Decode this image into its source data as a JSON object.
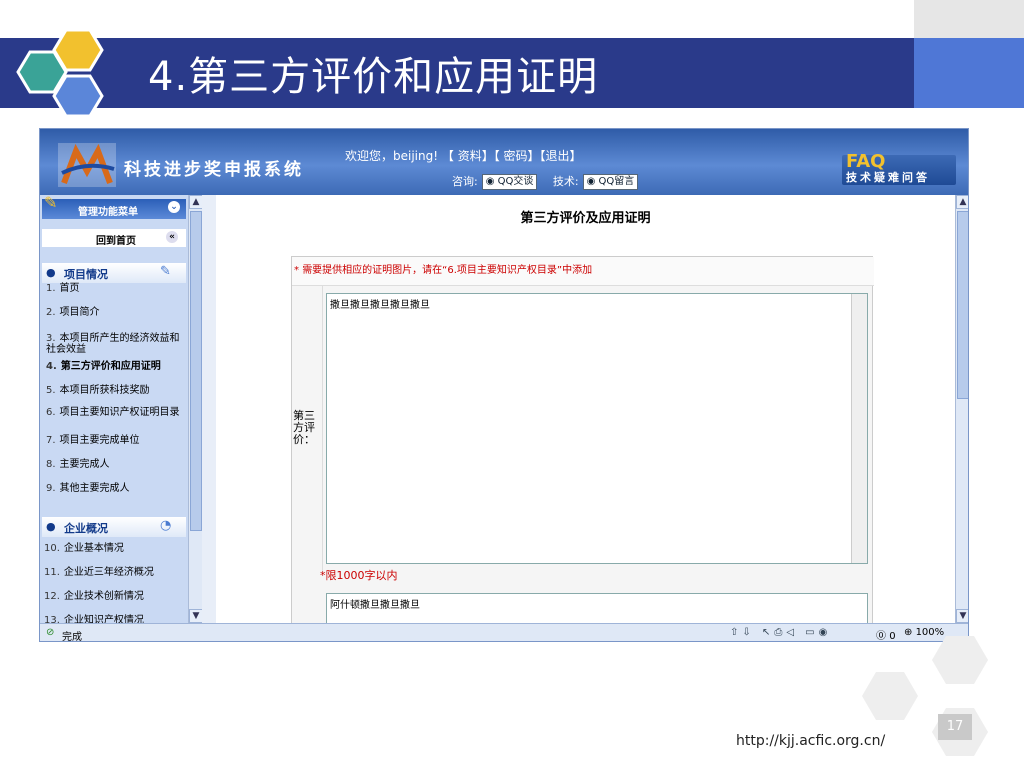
{
  "slide": {
    "title": "4.第三方评价和应用证明",
    "url": "http://kjj.acfic.org.cn/",
    "page_number": "17"
  },
  "app": {
    "system_name": "科技进步奖申报系统",
    "welcome_text": "欢迎您，beijing!",
    "links": [
      "【 资料】",
      "【 密码】",
      "【退出】"
    ],
    "consult_label": "咨询:",
    "qq_chat": "QQ交谈",
    "tech_label": "技术:",
    "qq_message": "QQ留言",
    "faq_letters": "FAQ",
    "faq_caption": "技术疑难问答"
  },
  "sidebar": {
    "menu_title": "管理功能菜单",
    "back_home": "回到首页",
    "section1": "项目情况",
    "items1": [
      {
        "n": "1.",
        "label": "首页"
      },
      {
        "n": "2.",
        "label": "项目简介"
      },
      {
        "n": "3.",
        "label": "本项目所产生的经济效益和社会效益"
      },
      {
        "n": "4.",
        "label": "第三方评价和应用证明"
      },
      {
        "n": "5.",
        "label": "本项目所获科技奖励"
      },
      {
        "n": "6.",
        "label": "项目主要知识产权证明目录"
      },
      {
        "n": "7.",
        "label": "项目主要完成单位"
      },
      {
        "n": "8.",
        "label": "主要完成人"
      },
      {
        "n": "9.",
        "label": "其他主要完成人"
      }
    ],
    "section2": "企业概况",
    "items2": [
      {
        "n": "10.",
        "label": "企业基本情况"
      },
      {
        "n": "11.",
        "label": "企业近三年经济概况"
      },
      {
        "n": "12.",
        "label": "企业技术创新情况"
      },
      {
        "n": "13.",
        "label": "企业知识产权情况"
      }
    ]
  },
  "main": {
    "heading": "第三方评价及应用证明",
    "note_star": "*",
    "note_text": "需要提供相应的证明图片，请在“6.项目主要知识产权目录”中添加",
    "field_label": "第三方评价：",
    "field_value": "撒旦撒旦撒旦撒旦撒旦",
    "limit_text": "*限1000字以内",
    "field2_value": "阿什顿撒旦撒旦撒旦"
  },
  "statusbar": {
    "status": "完成",
    "counter": "0",
    "zoom": "100%"
  },
  "colors": {
    "title_bar": "#2a3a8a",
    "accent_blue": "#4f77d6",
    "header_blue": "#3d6ab5",
    "required_red": "#cc0000"
  }
}
